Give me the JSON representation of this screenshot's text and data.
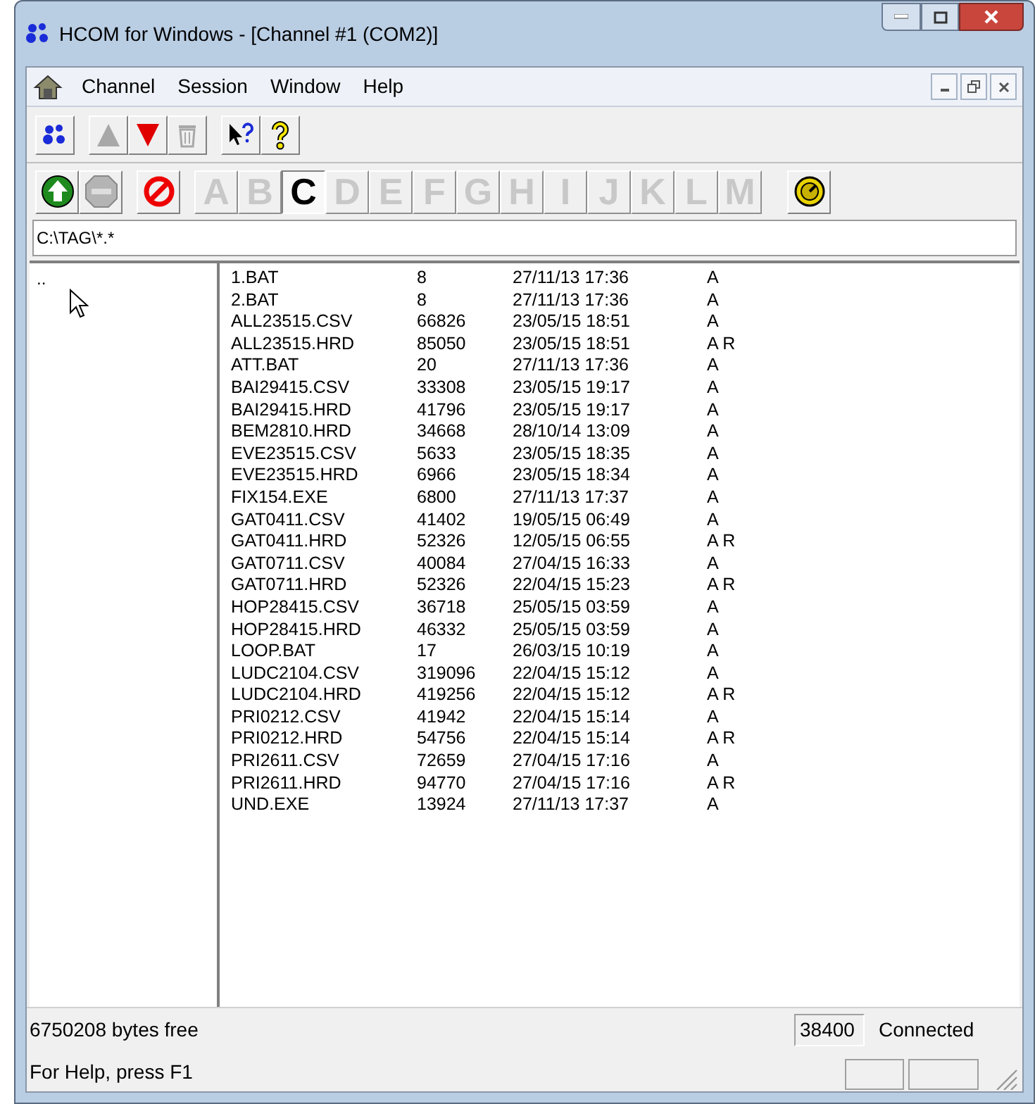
{
  "window": {
    "title": "HCOM for Windows - [Channel #1 (COM2)]"
  },
  "menu": [
    "Channel",
    "Session",
    "Window",
    "Help"
  ],
  "toolbar": [
    {
      "kind": "paws",
      "disabled": false
    },
    {
      "kind": "up",
      "disabled": true
    },
    {
      "kind": "down",
      "disabled": false
    },
    {
      "kind": "trash",
      "disabled": true
    },
    {
      "kind": "whatsthis",
      "disabled": false
    },
    {
      "kind": "help",
      "disabled": false
    }
  ],
  "drive_bar": {
    "connect_disabled": false,
    "stop_disabled": true,
    "drives": [
      {
        "letter": "A",
        "selected": false
      },
      {
        "letter": "B",
        "selected": false
      },
      {
        "letter": "C",
        "selected": true
      },
      {
        "letter": "D",
        "selected": false
      },
      {
        "letter": "E",
        "selected": false
      },
      {
        "letter": "F",
        "selected": false
      },
      {
        "letter": "G",
        "selected": false
      },
      {
        "letter": "H",
        "selected": false
      },
      {
        "letter": "I",
        "selected": false
      },
      {
        "letter": "J",
        "selected": false
      },
      {
        "letter": "K",
        "selected": false
      },
      {
        "letter": "L",
        "selected": false
      },
      {
        "letter": "M",
        "selected": false
      }
    ]
  },
  "path": "C:\\TAG\\*.*",
  "folders": [
    ".."
  ],
  "files": [
    {
      "name": "1.BAT",
      "size": "8",
      "date": "27/11/13 17:36",
      "attrs": "A"
    },
    {
      "name": "2.BAT",
      "size": "8",
      "date": "27/11/13 17:36",
      "attrs": "A"
    },
    {
      "name": "ALL23515.CSV",
      "size": "66826",
      "date": "23/05/15 18:51",
      "attrs": "A"
    },
    {
      "name": "ALL23515.HRD",
      "size": "85050",
      "date": "23/05/15 18:51",
      "attrs": "A R"
    },
    {
      "name": "ATT.BAT",
      "size": "20",
      "date": "27/11/13 17:36",
      "attrs": "A"
    },
    {
      "name": "BAI29415.CSV",
      "size": "33308",
      "date": "23/05/15 19:17",
      "attrs": "A"
    },
    {
      "name": "BAI29415.HRD",
      "size": "41796",
      "date": "23/05/15 19:17",
      "attrs": "A"
    },
    {
      "name": "BEM2810.HRD",
      "size": "34668",
      "date": "28/10/14 13:09",
      "attrs": "A"
    },
    {
      "name": "EVE23515.CSV",
      "size": "5633",
      "date": "23/05/15 18:35",
      "attrs": "A"
    },
    {
      "name": "EVE23515.HRD",
      "size": "6966",
      "date": "23/05/15 18:34",
      "attrs": "A"
    },
    {
      "name": "FIX154.EXE",
      "size": "6800",
      "date": "27/11/13 17:37",
      "attrs": "A"
    },
    {
      "name": "GAT0411.CSV",
      "size": "41402",
      "date": "19/05/15 06:49",
      "attrs": "A"
    },
    {
      "name": "GAT0411.HRD",
      "size": "52326",
      "date": "12/05/15 06:55",
      "attrs": "A R"
    },
    {
      "name": "GAT0711.CSV",
      "size": "40084",
      "date": "27/04/15 16:33",
      "attrs": "A"
    },
    {
      "name": "GAT0711.HRD",
      "size": "52326",
      "date": "22/04/15 15:23",
      "attrs": "A R"
    },
    {
      "name": "HOP28415.CSV",
      "size": "36718",
      "date": "25/05/15 03:59",
      "attrs": "A"
    },
    {
      "name": "HOP28415.HRD",
      "size": "46332",
      "date": "25/05/15 03:59",
      "attrs": "A"
    },
    {
      "name": "LOOP.BAT",
      "size": "17",
      "date": "26/03/15 10:19",
      "attrs": "A"
    },
    {
      "name": "LUDC2104.CSV",
      "size": "319096",
      "date": "22/04/15 15:12",
      "attrs": "A"
    },
    {
      "name": "LUDC2104.HRD",
      "size": "419256",
      "date": "22/04/15 15:12",
      "attrs": "A R"
    },
    {
      "name": "PRI0212.CSV",
      "size": "41942",
      "date": "22/04/15 15:14",
      "attrs": "A"
    },
    {
      "name": "PRI0212.HRD",
      "size": "54756",
      "date": "22/04/15 15:14",
      "attrs": "A R"
    },
    {
      "name": "PRI2611.CSV",
      "size": "72659",
      "date": "27/04/15 17:16",
      "attrs": "A"
    },
    {
      "name": "PRI2611.HRD",
      "size": "94770",
      "date": "27/04/15 17:16",
      "attrs": "A R"
    },
    {
      "name": "UND.EXE",
      "size": "13924",
      "date": "27/11/13 17:37",
      "attrs": "A"
    }
  ],
  "status_bar": {
    "free": "6750208 bytes free",
    "baud": "38400",
    "connection": "Connected",
    "help": "For Help, press F1"
  }
}
